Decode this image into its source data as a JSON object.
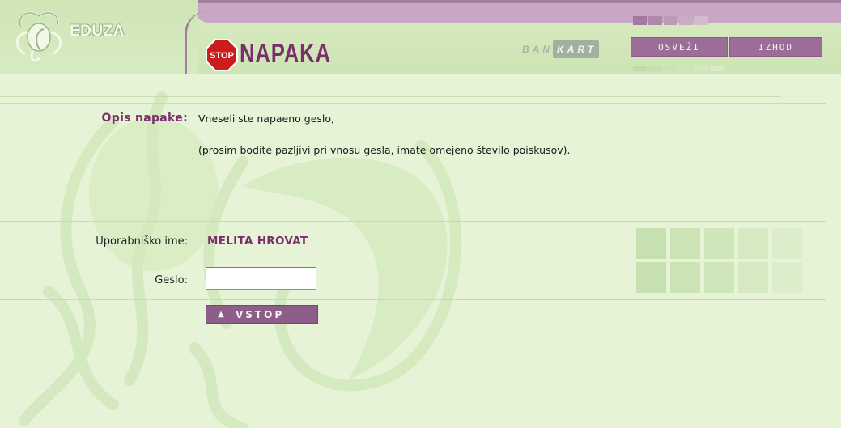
{
  "header": {
    "logo_text": "EDUZA",
    "title": "NAPAKA",
    "stop_sign_text": "STOP",
    "bankart": {
      "prefix": "BAN",
      "suffix": "KART"
    },
    "nav": {
      "refresh_label": "OSVEŽI",
      "logout_label": "IZHOD"
    }
  },
  "error": {
    "label": "Opis napake:",
    "line1": "Vneseli ste napaeno geslo,",
    "line2": "(prosim bodite pazljivi pri vnosu gesla, imate omejeno število poiskusov)."
  },
  "login": {
    "username_label": "Uporabniško ime:",
    "username_value": "MELITA HROVAT",
    "password_label": "Geslo:",
    "password_value": "",
    "submit_label": "VSTOP",
    "submit_icon": "up-triangle-icon"
  },
  "colors": {
    "background": "#e6f3d6",
    "accent_purple": "#7a2f6d",
    "button_purple": "#9c6d98",
    "header_band": "#c8a6c4"
  }
}
